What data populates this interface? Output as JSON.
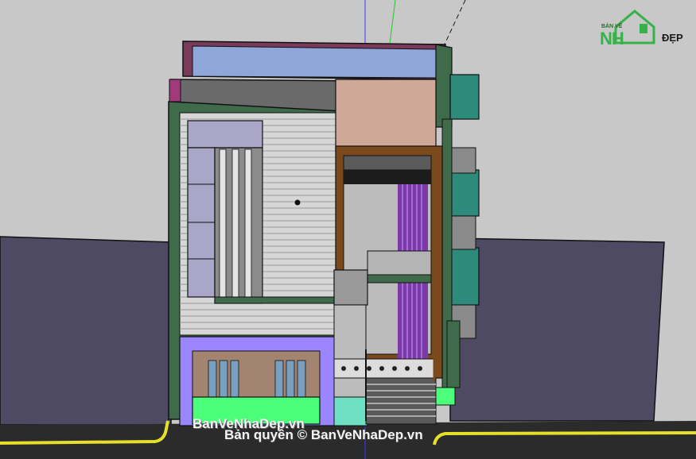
{
  "logo": {
    "top_text": "BẢN VẼ",
    "nh_text": "NH",
    "dep_text": "ĐẸP"
  },
  "watermark": {
    "url_text": "BanVeNhaDep.vn",
    "copyright_text": "Bản quyền © BanVeNhaDep.vn"
  },
  "colors": {
    "sky": "#c8c8c8",
    "neighbor": "#4e4a64",
    "ground": "#2a2a2a",
    "curb": "#e6e02a",
    "facade_frame": "#3f6b4a",
    "roof_glass": "#8fa6d8",
    "purple_walls": "#9b86ff",
    "green_planter": "#4cff7a",
    "brown_frame": "#7a4a1c",
    "purple_curtain": "#7a3aa8"
  }
}
